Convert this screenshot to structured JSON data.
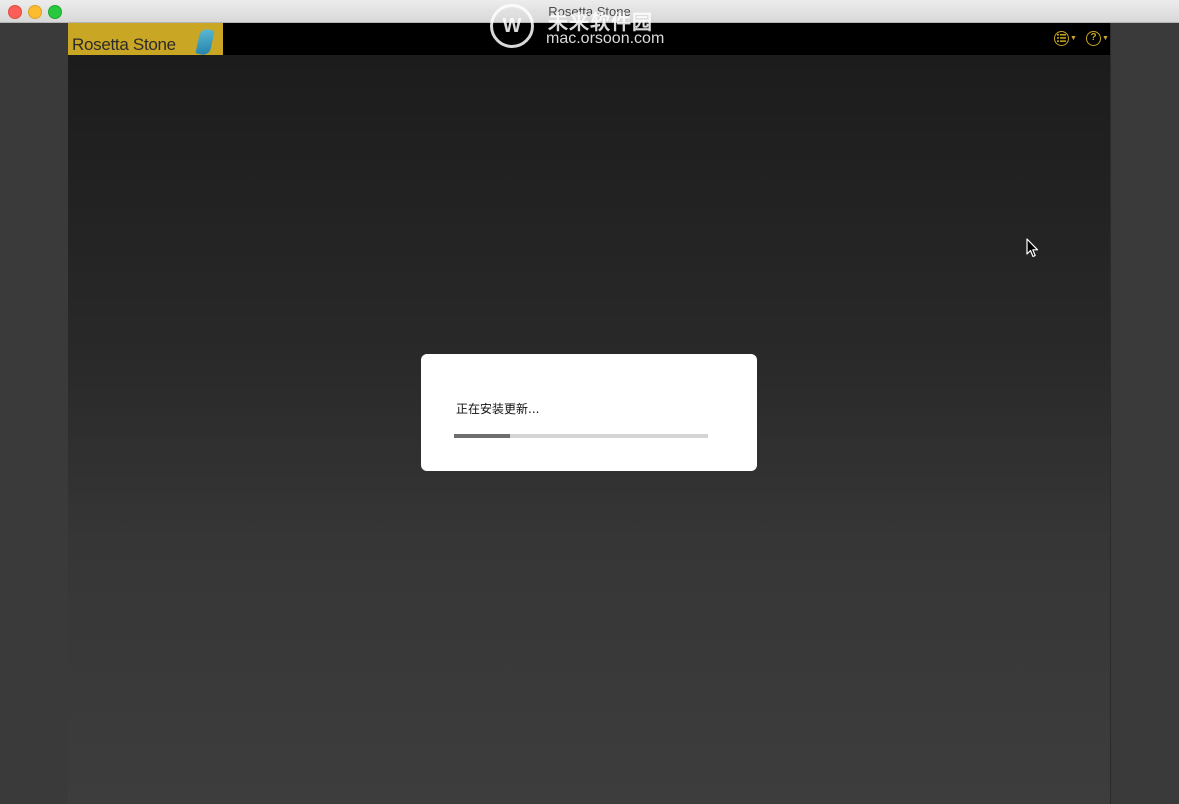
{
  "window": {
    "title": "Rosetta Stone"
  },
  "header": {
    "logo_text": "Rosetta Stone",
    "menu_icon": "list-icon",
    "help_icon": "help-icon",
    "help_glyph": "?"
  },
  "watermark": {
    "logo_letter": "W",
    "chinese_text": "未来软件园",
    "url": "mac.orsoon.com"
  },
  "dialog": {
    "message": "正在安装更新...",
    "progress_fraction": 0.22
  },
  "colors": {
    "brand_gold": "#c9a623",
    "header_bg": "#000000",
    "dialog_bg": "#ffffff",
    "progress_fill": "#6e6e6e",
    "progress_track": "#d4d4d4"
  }
}
